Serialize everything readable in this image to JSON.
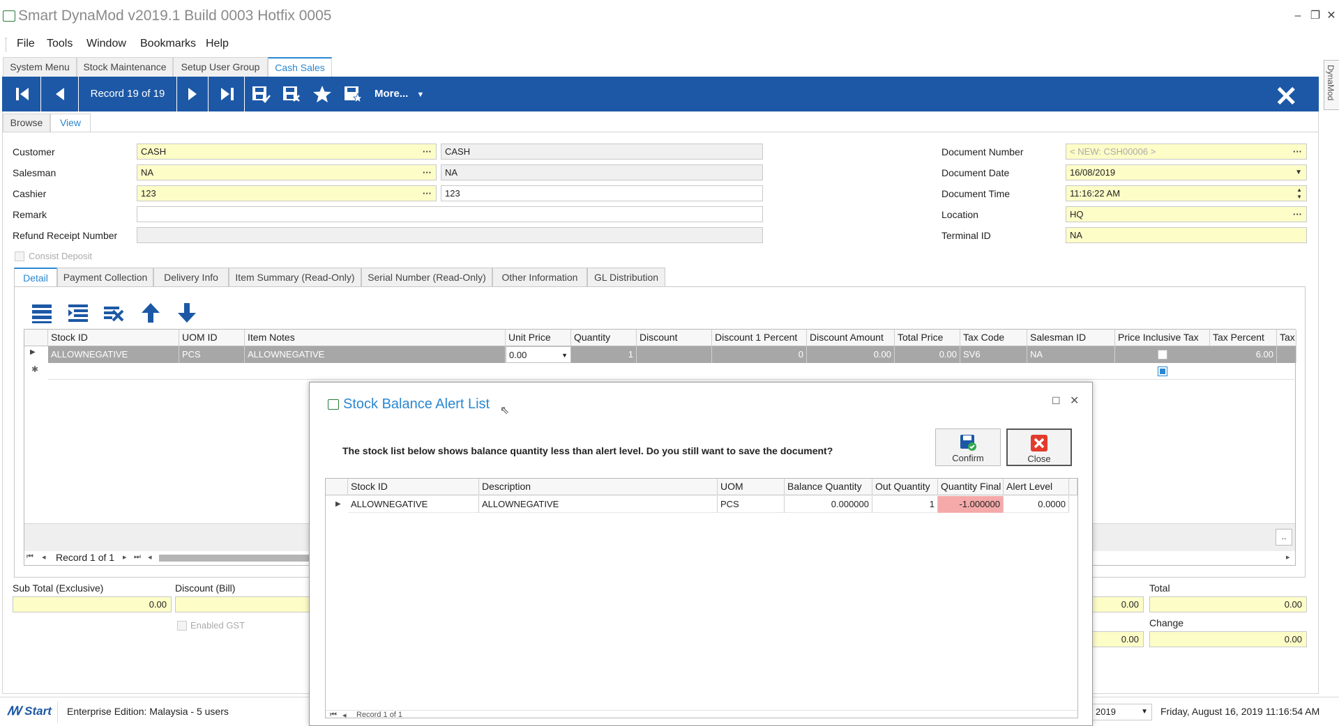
{
  "window": {
    "title": "Smart DynaMod v2019.1 Build 0003 Hotfix 0005"
  },
  "menu": [
    "File",
    "Tools",
    "Window",
    "Bookmarks",
    "Help"
  ],
  "doc_tabs": [
    "System Menu",
    "Stock Maintenance",
    "Setup User Group",
    "Cash Sales"
  ],
  "side_tab": "DynaMod",
  "toolbar": {
    "record_text": "Record 19 of 19",
    "more_label": "More..."
  },
  "view_tabs": [
    "Browse",
    "View"
  ],
  "form": {
    "customer_label": "Customer",
    "customer_code": "CASH",
    "customer_name": "CASH",
    "salesman_label": "Salesman",
    "salesman_code": "NA",
    "salesman_name": "NA",
    "cashier_label": "Cashier",
    "cashier_code": "123",
    "cashier_name": "123",
    "remark_label": "Remark",
    "remark_value": "",
    "refund_label": "Refund Receipt Number",
    "refund_value": "",
    "consist_deposit_label": "Consist Deposit",
    "doc_number_label": "Document Number",
    "doc_number_value": "< NEW: CSH00006 >",
    "doc_date_label": "Document Date",
    "doc_date_value": "16/08/2019",
    "doc_time_label": "Document Time",
    "doc_time_value": "11:16:22 AM",
    "location_label": "Location",
    "location_value": "HQ",
    "terminal_label": "Terminal ID",
    "terminal_value": "NA"
  },
  "detail_tabs": [
    "Detail",
    "Payment Collection",
    "Delivery Info",
    "Item Summary (Read-Only)",
    "Serial Number (Read-Only)",
    "Other Information",
    "GL Distribution"
  ],
  "grid": {
    "columns": [
      "Stock ID",
      "UOM ID",
      "Item Notes",
      "Unit Price",
      "Quantity",
      "Discount",
      "Discount 1 Percent",
      "Discount Amount",
      "Total Price",
      "Tax Code",
      "Salesman ID",
      "Price Inclusive Tax",
      "Tax Percent",
      "Tax"
    ],
    "row": {
      "stock_id": "ALLOWNEGATIVE",
      "uom_id": "PCS",
      "item_notes": "ALLOWNEGATIVE",
      "unit_price": "0.00",
      "quantity": "1",
      "discount": "",
      "discount1_percent": "0",
      "discount_amount": "0.00",
      "total_price": "0.00",
      "tax_code": "SV6",
      "salesman_id": "NA",
      "tax_percent": "6.00"
    },
    "nav_text": "Record 1 of 1",
    "ellipsis": ".."
  },
  "totals": {
    "subtotal_label": "Sub Total (Exclusive)",
    "subtotal_value": "0.00",
    "discount_bill_label": "Discount (Bill)",
    "enabled_gst_label": "Enabled GST",
    "hidden_value_1": "0.00",
    "hidden_value_2": "0.00",
    "total_label": "Total",
    "total_value": "0.00",
    "change_label": "Change",
    "change_value": "0.00"
  },
  "status": {
    "start_label": "Start",
    "edition": "Enterprise Edition: Malaysia - 5 users",
    "year_value": "2019",
    "datetime": "Friday, August 16, 2019 11:16:54 AM"
  },
  "dialog": {
    "title": "Stock Balance Alert List",
    "message": "The stock list below shows balance quantity less than alert level. Do you still want to save the document?",
    "confirm_label": "Confirm",
    "close_label": "Close",
    "columns": [
      "Stock ID",
      "Description",
      "UOM",
      "Balance Quantity",
      "Out Quantity",
      "Quantity Final",
      "Alert Level"
    ],
    "row": {
      "stock_id": "ALLOWNEGATIVE",
      "description": "ALLOWNEGATIVE",
      "uom": "PCS",
      "balance_qty": "0.000000",
      "out_qty": "1",
      "qty_final": "-1.000000",
      "alert_level": "0.0000"
    },
    "nav_text": "Record 1 of 1"
  },
  "colors": {
    "toolbar_blue": "#1c58a6",
    "accent_blue": "#2b87d1",
    "required_yellow": "#fdfdc8",
    "negative_red": "#f5a9a9"
  }
}
